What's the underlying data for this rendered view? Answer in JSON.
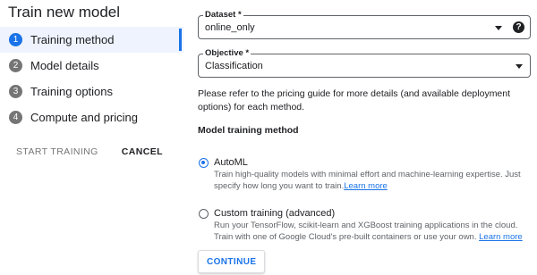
{
  "page_title": "Train new model",
  "steps": [
    {
      "number": "1",
      "label": "Training method"
    },
    {
      "number": "2",
      "label": "Model details"
    },
    {
      "number": "3",
      "label": "Training options"
    },
    {
      "number": "4",
      "label": "Compute and pricing"
    }
  ],
  "actions": {
    "start_training": "START TRAINING",
    "cancel": "CANCEL"
  },
  "dataset": {
    "label": "Dataset *",
    "value": "online_only",
    "help_icon": "?"
  },
  "objective": {
    "label": "Objective *",
    "value": "Classification"
  },
  "pricing_note": "Please refer to the pricing guide for more details (and available deployment options) for each method.",
  "section_title": "Model training method",
  "methods": [
    {
      "title": "AutoML",
      "description": "Train high-quality models with minimal effort and machine-learning expertise. Just specify how long you want to train.",
      "link": "Learn more",
      "selected": true
    },
    {
      "title": "Custom training (advanced)",
      "description": "Run your TensorFlow, scikit-learn and XGBoost training applications in the cloud. Train with one of Google Cloud's pre-built containers or use your own.",
      "link": "Learn more",
      "selected": false
    }
  ],
  "continue_label": "CONTINUE",
  "colors": {
    "accent": "#1a73e8",
    "active_step_bg": "#eef3fd"
  }
}
